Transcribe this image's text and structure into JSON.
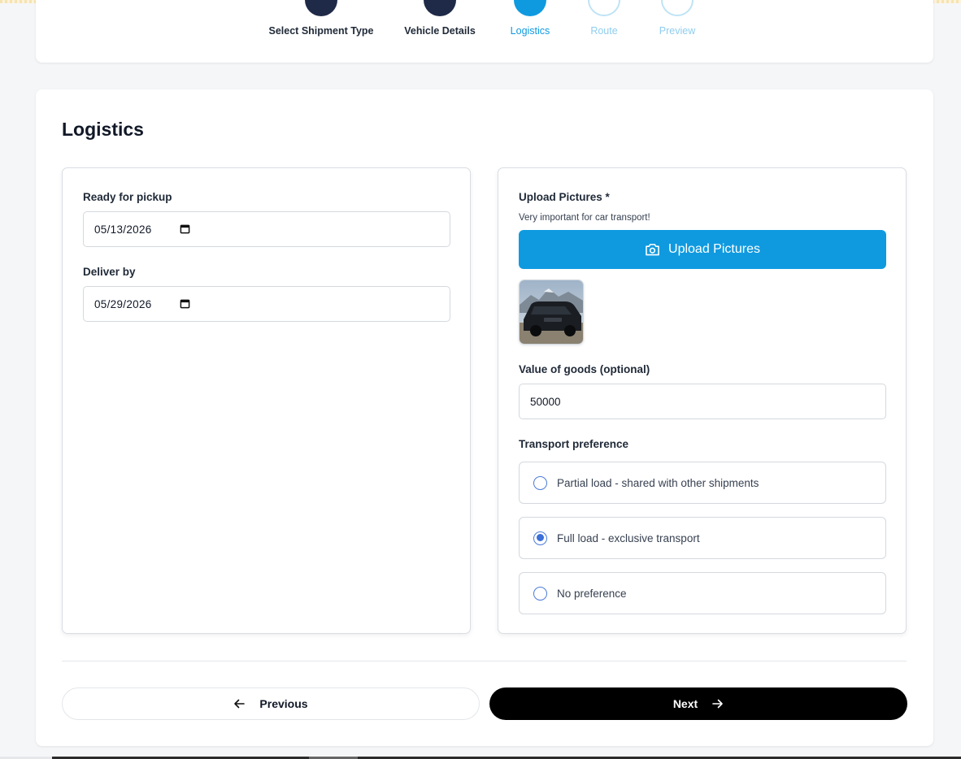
{
  "stepper": {
    "steps": [
      {
        "label": "Select Shipment Type",
        "state": "done"
      },
      {
        "label": "Vehicle Details",
        "state": "done"
      },
      {
        "label": "Logistics",
        "state": "active"
      },
      {
        "label": "Route",
        "state": "pending"
      },
      {
        "label": "Preview",
        "state": "pending"
      }
    ]
  },
  "page": {
    "title": "Logistics"
  },
  "left_panel": {
    "pickup": {
      "label": "Ready for pickup",
      "value": "05/13/2026"
    },
    "deliver": {
      "label": "Deliver by",
      "value": "05/29/2026"
    }
  },
  "right_panel": {
    "upload": {
      "label": "Upload Pictures *",
      "hint": "Very important for car transport!",
      "button_label": "Upload Pictures"
    },
    "value_of_goods": {
      "label": "Value of goods (optional)",
      "value": "50000"
    },
    "transport_preference": {
      "label": "Transport preference",
      "options": [
        {
          "label": "Partial load - shared with other shipments",
          "checked": false
        },
        {
          "label": "Full load - exclusive transport",
          "checked": true
        },
        {
          "label": "No preference",
          "checked": false
        }
      ]
    }
  },
  "navigation": {
    "previous_label": "Previous",
    "next_label": "Next"
  },
  "colors": {
    "accent": "#0f9ae0",
    "step_done": "#1e2a47",
    "step_pending": "#bfe3f6",
    "radio": "#3b6fd9",
    "next_button": "#000000"
  },
  "icons": {
    "calendar": "calendar-icon",
    "camera": "camera-icon",
    "arrow_left": "arrow-left-icon",
    "arrow_right": "arrow-right-icon"
  }
}
